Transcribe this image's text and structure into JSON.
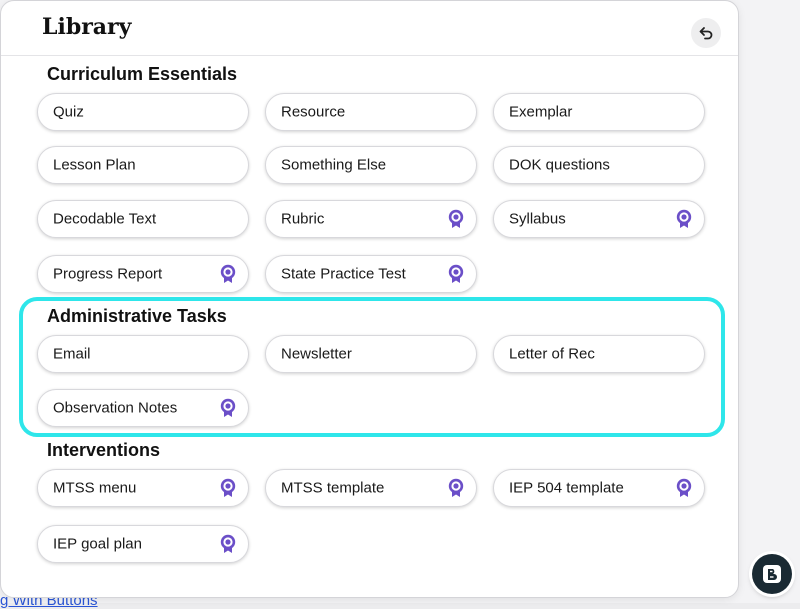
{
  "background": {
    "link_text": "g With Buttons"
  },
  "library": {
    "title": "Library",
    "back_icon": "undo-arrow-icon",
    "sections": [
      {
        "title": "Curriculum Essentials",
        "items": [
          {
            "label": "Quiz",
            "premium": false
          },
          {
            "label": "Resource",
            "premium": false
          },
          {
            "label": "Exemplar",
            "premium": false
          },
          {
            "label": "Lesson Plan",
            "premium": false
          },
          {
            "label": "Something Else",
            "premium": false
          },
          {
            "label": "DOK questions",
            "premium": false
          },
          {
            "label": "Decodable Text",
            "premium": false
          },
          {
            "label": "Rubric",
            "premium": true
          },
          {
            "label": "Syllabus",
            "premium": true
          },
          {
            "label": "Progress Report",
            "premium": true
          },
          {
            "label": "State Practice Test",
            "premium": true
          }
        ]
      },
      {
        "title": "Administrative Tasks",
        "highlighted": true,
        "items": [
          {
            "label": "Email",
            "premium": false
          },
          {
            "label": "Newsletter",
            "premium": false
          },
          {
            "label": "Letter of Rec",
            "premium": false
          },
          {
            "label": "Observation Notes",
            "premium": true
          }
        ]
      },
      {
        "title": "Interventions",
        "items": [
          {
            "label": "MTSS menu",
            "premium": true
          },
          {
            "label": "MTSS template",
            "premium": true
          },
          {
            "label": "IEP 504 template",
            "premium": true
          },
          {
            "label": "IEP goal plan",
            "premium": true
          }
        ]
      }
    ]
  },
  "premium_icon": "award-badge-icon",
  "fab_icon": "brisk-logo-icon",
  "colors": {
    "highlight": "#2ee6ea",
    "premium_badge": "#6b4fc8",
    "fab_background": "#1a2a33"
  }
}
